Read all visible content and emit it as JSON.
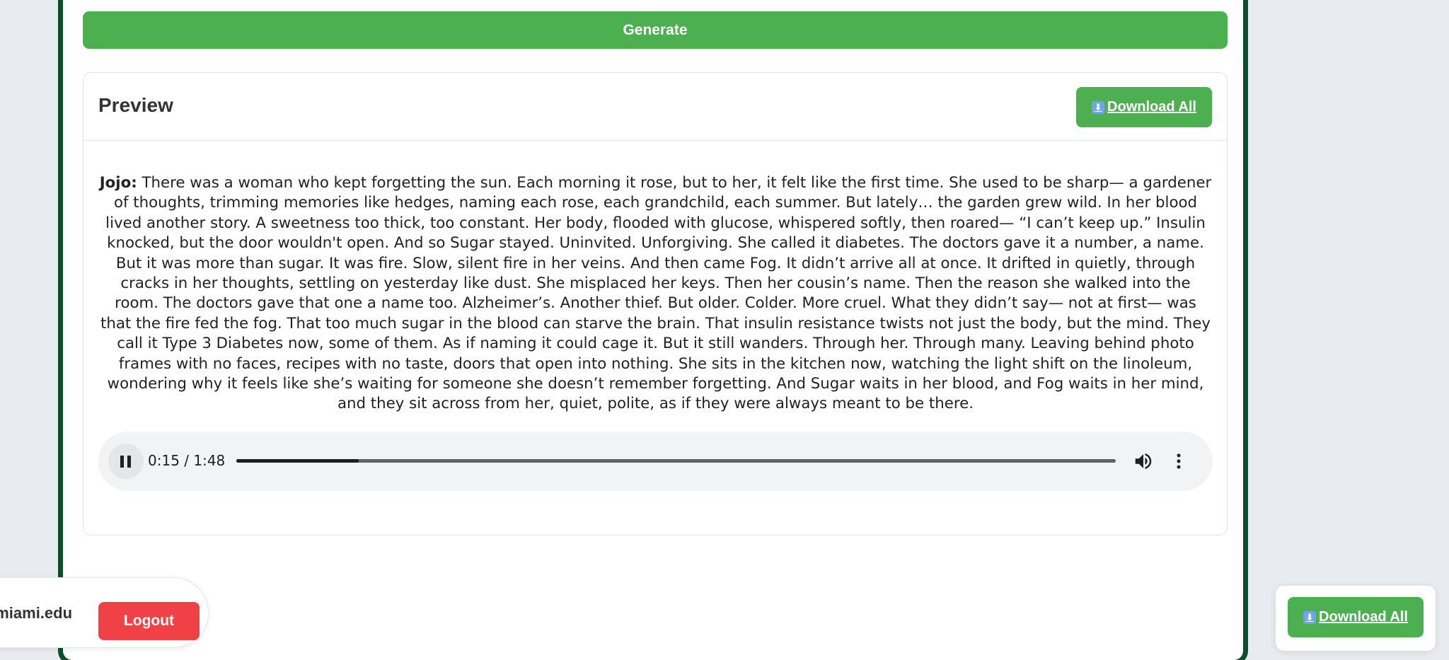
{
  "generate": {
    "label": "Generate"
  },
  "preview": {
    "title": "Preview",
    "download_all_label": "Download All",
    "download_icon": "download-arrow-icon",
    "speaker": "Jojo:",
    "story": " There was a woman who kept forgetting the sun. Each morning it rose, but to her, it felt like the first time. She used to be sharp— a gardener of thoughts, trimming memories like hedges, naming each rose, each grandchild, each summer. But lately… the garden grew wild. In her blood lived another story. A sweetness too thick, too constant. Her body, flooded with glucose, whispered softly, then roared— “I can’t keep up.” Insulin knocked, but the door wouldn't open. And so Sugar stayed. Uninvited. Unforgiving. She called it diabetes. The doctors gave it a number, a name. But it was more than sugar. It was fire. Slow, silent fire in her veins. And then came Fog. It didn’t arrive all at once. It drifted in quietly, through cracks in her thoughts, settling on yesterday like dust. She misplaced her keys. Then her cousin’s name. Then the reason she walked into the room. The doctors gave that one a name too. Alzheimer’s. Another thief. But older. Colder. More cruel. What they didn’t say— not at first— was that the fire fed the fog. That too much sugar in the blood can starve the brain. That insulin resistance twists not just the body, but the mind. They call it Type 3 Diabetes now, some of them. As if naming it could cage it. But it still wanders. Through her. Through many. Leaving behind photo frames with no faces, recipes with no taste, doors that open into nothing. She sits in the kitchen now, watching the light shift on the linoleum, wondering why it feels like she’s waiting for someone she doesn’t remember forgetting. And Sugar waits in her blood, and Fog waits in her mind, and they sit across from her, quiet, polite, as if they were always meant to be there."
  },
  "audio": {
    "time_display": "0:15 / 1:48",
    "progress_fraction": 0.139,
    "state": "playing"
  },
  "user_bar": {
    "email_visible": "l.miami.edu",
    "logout_label": "Logout"
  },
  "floating": {
    "download_all_label": "Download All"
  },
  "colors": {
    "accent_green": "#4caf50",
    "frame_dark_green": "#0d4d2c",
    "logout_red": "#ef4146",
    "background": "#e8ebef"
  }
}
